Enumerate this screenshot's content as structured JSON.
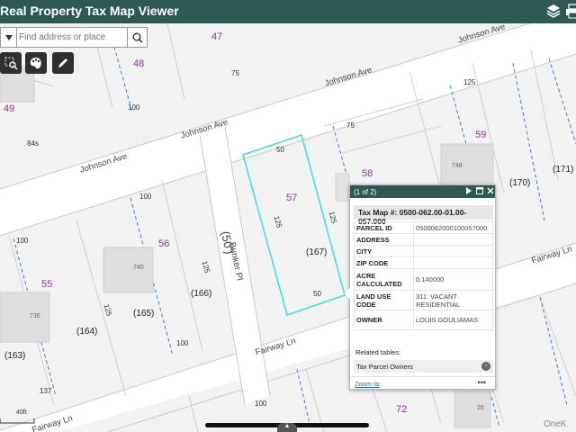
{
  "app": {
    "title": "Real Property Tax Map Viewer"
  },
  "header_icons": [
    "layers-icon",
    "print-icon"
  ],
  "search": {
    "placeholder": "Find address or place"
  },
  "tools": [
    "select-parcel-icon",
    "palette-icon",
    "measure-pencil-icon"
  ],
  "map": {
    "street_labels": {
      "johnson_ave_1": "Johnson Ave",
      "johnson_ave_2": "Johnson Ave",
      "johnson_ave_3": "Johnson Ave",
      "johnson_ave_4": "Johnson Ave",
      "bunker_pl": "Bunker Pl",
      "bunker_width": "(50')",
      "fairway_ln_1": "Fairway Ln",
      "fairway_ln_2": "Fairway Ln",
      "fairway_ln_3": "Fairway Ln"
    },
    "lot_numbers": [
      "47",
      "48",
      "49",
      "59",
      "58",
      "57",
      "56",
      "55",
      "72"
    ],
    "parcel_ids": [
      "(167)",
      "(166)",
      "(165)",
      "(164)",
      "(163)",
      "(170)",
      "(171)"
    ],
    "dimensions": [
      "75",
      "125",
      "100",
      "84s",
      "75",
      "50",
      "125",
      "125",
      "50",
      "100",
      "125",
      "100",
      "125",
      "100",
      "137",
      "748",
      "740",
      "736",
      "100",
      "26"
    ],
    "selected_parcel_color": "#35e0dd"
  },
  "popup": {
    "count": "(1 of 2)",
    "title": "Tax Map #: 0500-062.00-01.00-057.000",
    "rows": [
      {
        "k": "PARCEL ID",
        "v": "0500062000100057000"
      },
      {
        "k": "ADDRESS",
        "v": ""
      },
      {
        "k": "CITY",
        "v": ""
      },
      {
        "k": "ZIP CODE",
        "v": ""
      },
      {
        "k": "ACRE CALCULATED",
        "v": "0.140000"
      },
      {
        "k": "LAND USE CODE",
        "v": "311: VACANT RESIDENTIAL"
      },
      {
        "k": "OWNER",
        "v": "LOUIS GOULIAMAS"
      }
    ],
    "related_label": "Related tables:",
    "related_table": "Tax Parcel Owners",
    "zoom_label": "Zoom to",
    "more_label": "•••"
  },
  "scale": {
    "label": "40ft"
  },
  "watermark": "OneK"
}
